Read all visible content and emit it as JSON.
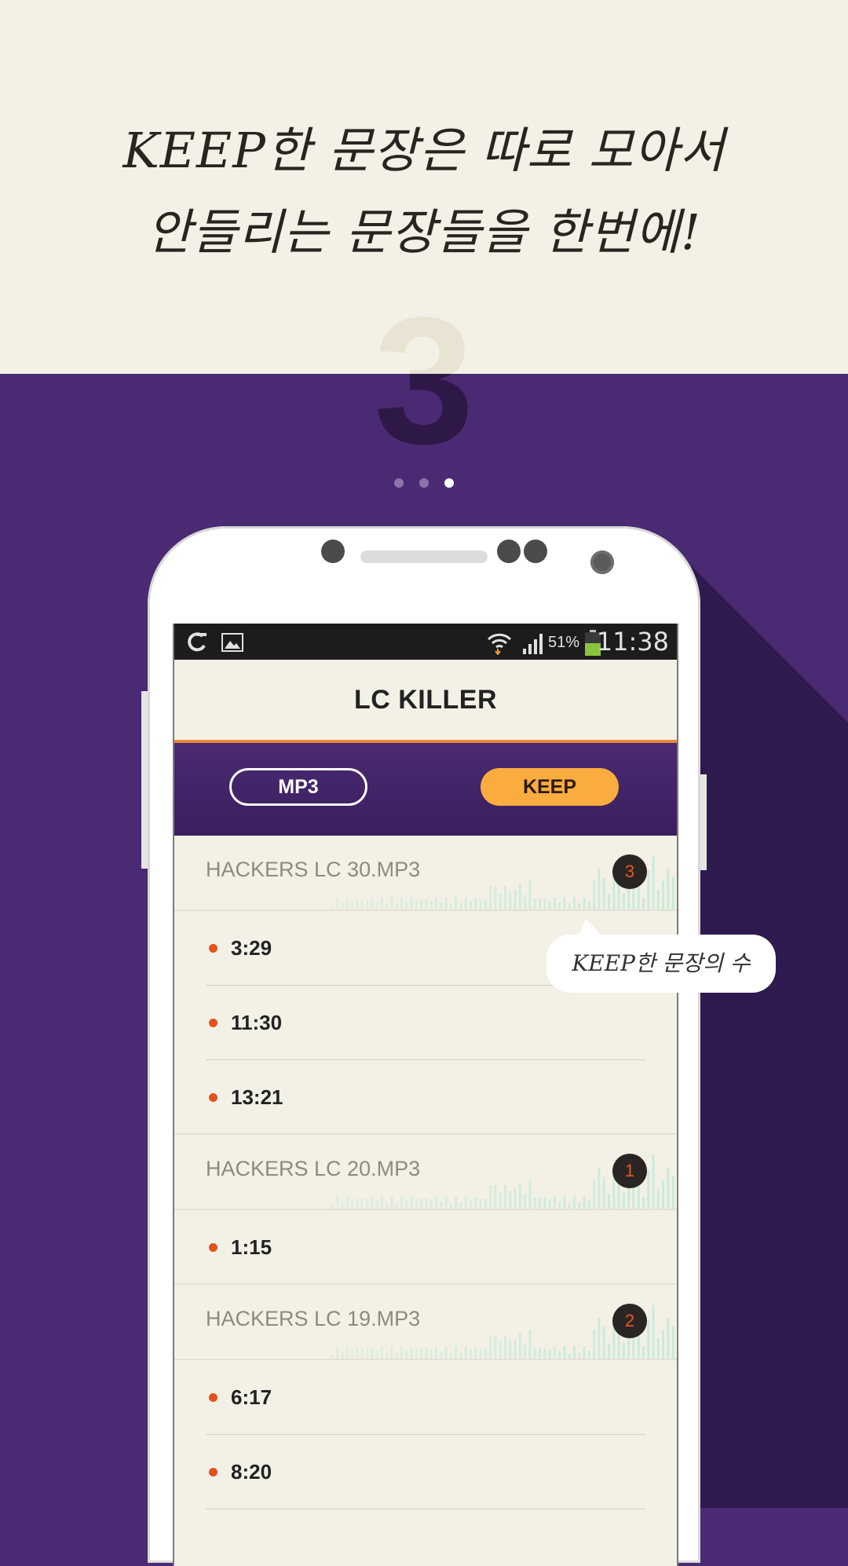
{
  "promo": {
    "headline_line1": "KEEP한 문장은 따로 모아서",
    "headline_line2": "안들리는 문장들을 한번에!",
    "step_number": "3",
    "page_dots": 3,
    "active_dot": 3
  },
  "statusbar": {
    "battery_percent": "51%",
    "time": "11:38",
    "icons": [
      "app-notification-icon",
      "image-icon",
      "wifi-icon",
      "signal-icon",
      "battery-icon"
    ]
  },
  "app": {
    "title": "LC KILLER",
    "tabs": {
      "mp3_label": "MP3",
      "keep_label": "KEEP",
      "active": "KEEP"
    }
  },
  "files": [
    {
      "name": "HACKERS LC 30.MP3",
      "count": "3",
      "times": [
        "3:29",
        "11:30",
        "13:21"
      ]
    },
    {
      "name": "HACKERS LC 20.MP3",
      "count": "1",
      "times": [
        "1:15"
      ]
    },
    {
      "name": "HACKERS LC 19.MP3",
      "count": "2",
      "times": [
        "6:17",
        "8:20"
      ]
    }
  ],
  "tooltip": {
    "text": "KEEP한 문장의 수"
  },
  "colors": {
    "background_top": "#f3f0e6",
    "background_purple": "#4a2a72",
    "accent_orange": "#fbac3e",
    "bullet_orange": "#e0531c"
  }
}
